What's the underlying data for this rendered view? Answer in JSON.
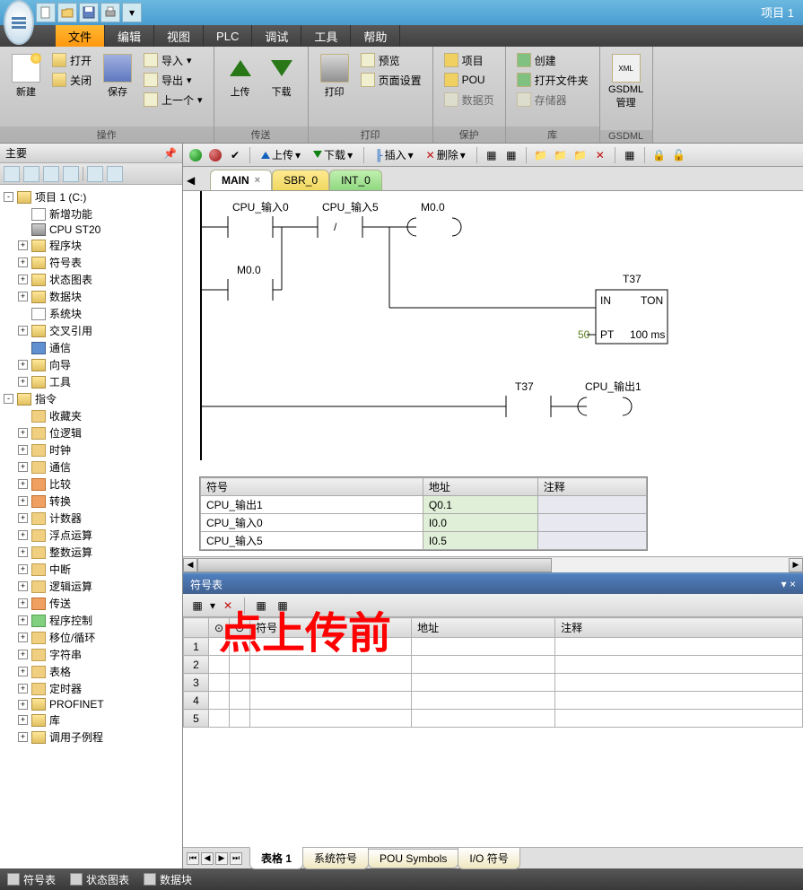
{
  "window": {
    "title": "项目 1"
  },
  "menubar": {
    "items": [
      "文件",
      "编辑",
      "视图",
      "PLC",
      "调试",
      "工具",
      "帮助"
    ],
    "active": 0
  },
  "ribbon": {
    "groups": [
      {
        "label": "操作",
        "items": {
          "new": "新建",
          "open": "打开",
          "close": "关闭",
          "save": "保存",
          "import": "导入",
          "export": "导出",
          "prev": "上一个"
        }
      },
      {
        "label": "传送",
        "items": {
          "upload": "上传",
          "download": "下载"
        }
      },
      {
        "label": "打印",
        "items": {
          "print": "打印",
          "preview": "预览",
          "pagesetup": "页面设置"
        }
      },
      {
        "label": "保护",
        "items": {
          "project": "项目",
          "pou": "POU",
          "datapage": "数据页"
        }
      },
      {
        "label": "库",
        "items": {
          "create": "创建",
          "openfolder": "打开文件夹",
          "memory": "存储器"
        }
      },
      {
        "label": "GSDML",
        "items": {
          "gsdml": "GSDML\n管理"
        }
      }
    ]
  },
  "leftpane": {
    "title": "主要",
    "tree": {
      "project": "项目 1 (C:)",
      "newfeat": "新增功能",
      "cpu": "CPU ST20",
      "progblock": "程序块",
      "symtable": "符号表",
      "statuschart": "状态图表",
      "datablock": "数据块",
      "sysblock": "系统块",
      "crossref": "交叉引用",
      "comm": "通信",
      "wizard": "向导",
      "tools": "工具",
      "instr": "指令",
      "favorites": "收藏夹",
      "bitlogic": "位逻辑",
      "clock": "时钟",
      "comm2": "通信",
      "compare": "比较",
      "convert": "转换",
      "counter": "计数器",
      "floatmath": "浮点运算",
      "intmath": "整数运算",
      "interrupt": "中断",
      "logicop": "逻辑运算",
      "transfer": "传送",
      "progctrl": "程序控制",
      "shiftrot": "移位/循环",
      "string": "字符串",
      "table": "表格",
      "timer": "定时器",
      "profinet": "PROFINET",
      "lib": "库",
      "callsub": "调用子例程"
    }
  },
  "toolbar2": {
    "upload": "上传",
    "download": "下载",
    "insert": "插入",
    "delete": "删除"
  },
  "editor_tabs": {
    "main": "MAIN",
    "sbr": "SBR_0",
    "int": "INT_0"
  },
  "ladder": {
    "contacts": {
      "cpu_in0": "CPU_输入0",
      "cpu_in5": "CPU_输入5",
      "m00": "M0.0",
      "m00b": "M0.0",
      "t37": "T37",
      "cpu_out1": "CPU_输出1"
    },
    "timer": {
      "name": "T37",
      "type": "TON",
      "in": "IN",
      "pt": "PT",
      "pt_val": "50",
      "time": "100 ms"
    }
  },
  "symtable_editor": {
    "headers": {
      "symbol": "符号",
      "address": "地址",
      "comment": "注释"
    },
    "rows": [
      {
        "symbol": "CPU_输出1",
        "address": "Q0.1",
        "comment": ""
      },
      {
        "symbol": "CPU_输入0",
        "address": "I0.0",
        "comment": ""
      },
      {
        "symbol": "CPU_输入5",
        "address": "I0.5",
        "comment": ""
      }
    ]
  },
  "bottompanel": {
    "title": "符号表",
    "headers": {
      "c1": "",
      "c2": "",
      "symbol": "符号",
      "address": "地址",
      "comment": "注释"
    },
    "rows": [
      "1",
      "2",
      "3",
      "4",
      "5"
    ],
    "overlay": "点上传前",
    "tabs": {
      "t1": "表格 1",
      "t2": "系统符号",
      "t3": "POU Symbols",
      "t4": "I/O 符号"
    }
  },
  "statusbar": {
    "symtable": "符号表",
    "statuschart": "状态图表",
    "datablock": "数据块"
  }
}
